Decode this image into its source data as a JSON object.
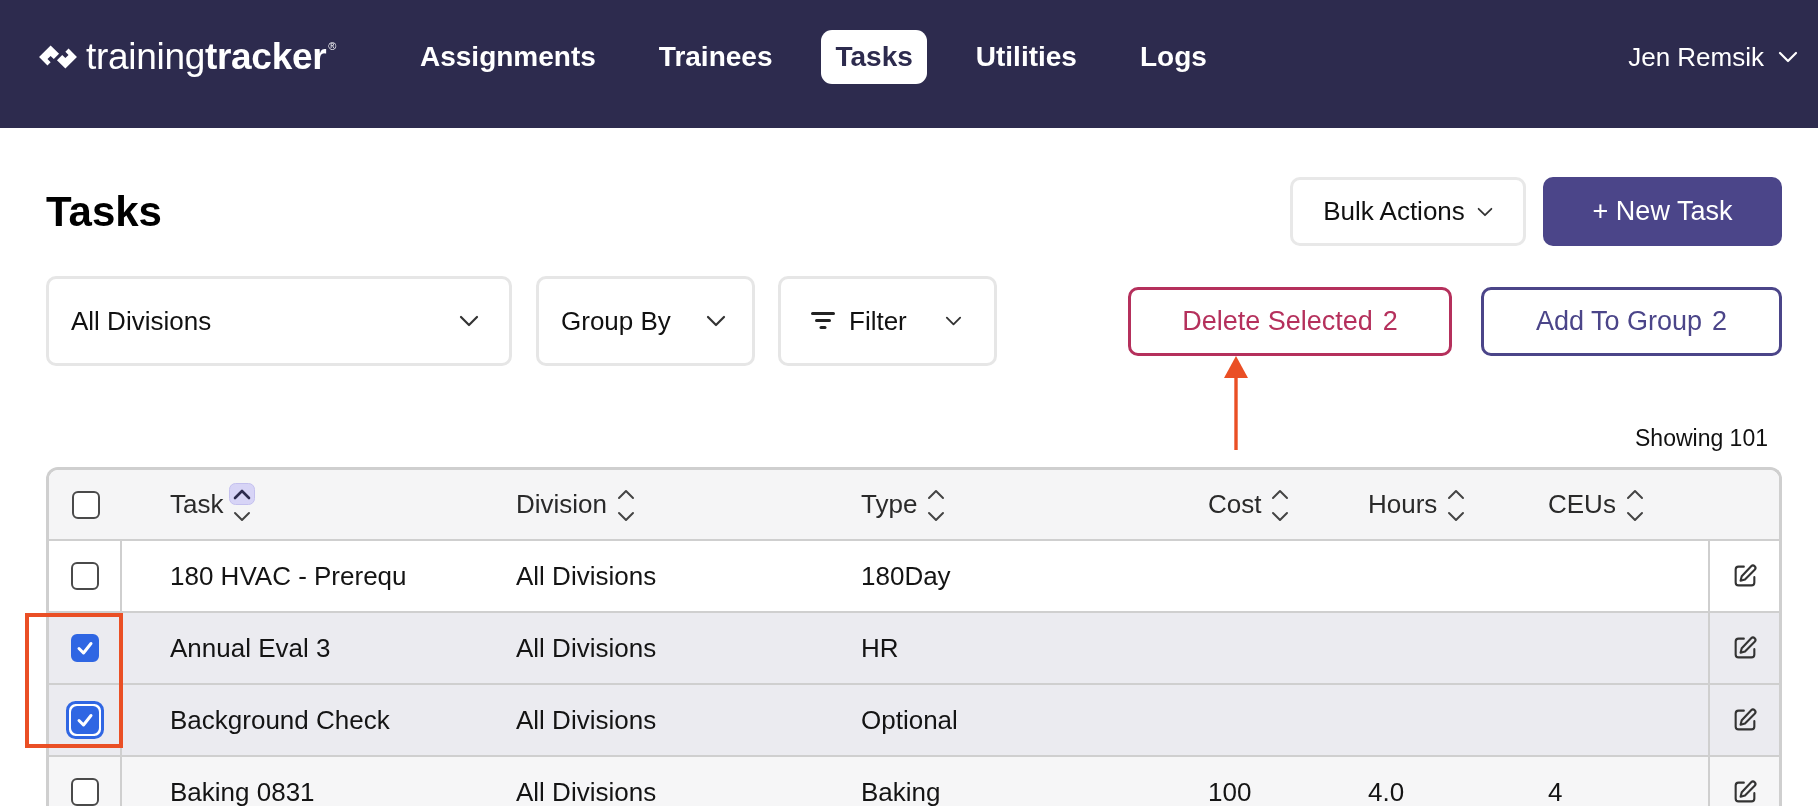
{
  "header": {
    "logo": "training**tracker**$^{®}$",
    "nav": [
      {
        "label": "Assignments",
        "selected": false
      },
      {
        "label": "Trainees",
        "selected": false
      },
      {
        "label": "Tasks",
        "selected": true
      },
      {
        "label": "Utilities",
        "selected": false
      },
      {
        "label": "Logs",
        "selected": false
      }
    ],
    "user": "Jen Remsik"
  },
  "page": {
    "title": "Tasks",
    "bulk_actions": "Bulk Actions",
    "new_task": "+ New Task"
  },
  "filters": {
    "division": "All Divisions",
    "group_by": "Group By",
    "filter": "Filter"
  },
  "selection_actions": [
    {
      "kind": "delete",
      "label": "Delete Selected",
      "count": "2"
    },
    {
      "kind": "group",
      "label": "Add To Group",
      "count": "2"
    }
  ],
  "showing": "Showing 101",
  "table": {
    "all_checked": false,
    "columns": [
      {
        "label": "Task",
        "sorted": true
      },
      {
        "label": "Division",
        "sorted": false
      },
      {
        "label": "Type",
        "sorted": false
      },
      {
        "label": "Cost",
        "sorted": false
      },
      {
        "label": "Hours",
        "sorted": false
      },
      {
        "label": "CEUs",
        "sorted": false
      }
    ],
    "rows": [
      {
        "checked": false,
        "focused": false,
        "task": "180 HVAC - Prerequ",
        "division": "All Divisions",
        "type": "180Day"
      },
      {
        "checked": true,
        "focused": false,
        "task": "Annual Eval 3",
        "division": "All Divisions",
        "type": "HR"
      },
      {
        "checked": true,
        "focused": true,
        "task": "Background Check",
        "division": "All Divisions",
        "type": "Optional"
      },
      {
        "checked": false,
        "focused": false,
        "task": "Baking 0831",
        "division": "All Divisions",
        "type": "Baking",
        "cost": "100",
        "hours": "4.0",
        "ceus": "4"
      }
    ]
  }
}
